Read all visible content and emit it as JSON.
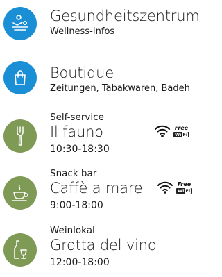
{
  "colors": {
    "blue": "#1a8fd6",
    "green": "#7e9a55"
  },
  "items": [
    {
      "icon": "spa-wellness-icon",
      "title": "Gesundheitszentrum",
      "subtitle": "Wellness-Infos"
    },
    {
      "icon": "shopping-bag-icon",
      "title": "Boutique",
      "subtitle": "Zeitungen, Tabakwaren, Badeh"
    },
    {
      "icon": "fork-icon",
      "kicker": "Self-service",
      "title": "Il fauno",
      "time": "10:30-18:30",
      "wifi": true
    },
    {
      "icon": "coffee-cup-icon",
      "kicker": "Snack bar",
      "title": "Caffè a mare",
      "time": "9:00-18:00",
      "wifi": true
    },
    {
      "icon": "wine-glass-icon",
      "kicker": "Weinlokal",
      "title": "Grotta del vino",
      "time": "12:00-18:00"
    }
  ],
  "wifi_badge": {
    "free": "Free",
    "wi": "Wi",
    "fi": "Fi"
  }
}
